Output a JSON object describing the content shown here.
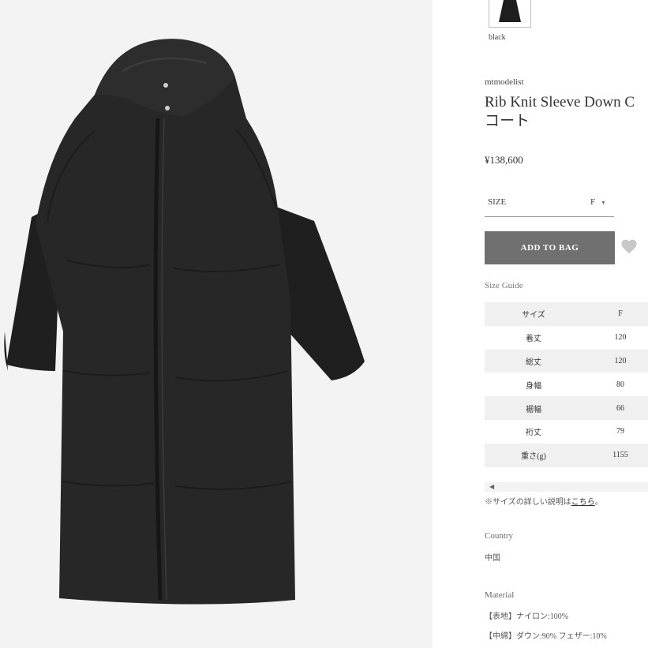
{
  "product": {
    "color_label": "black",
    "brand": "mtmodelist",
    "title_line1": "Rib Knit Sleeve Down C",
    "title_line2": "コート",
    "price": "¥138,600",
    "image_icon": "hooded-down-coat-image"
  },
  "size_select": {
    "label": "SIZE",
    "value": "F",
    "icon": "caret-down-icon"
  },
  "actions": {
    "add_to_bag": "ADD TO BAG",
    "wishlist_icon": "heart-icon"
  },
  "size_guide": {
    "link": "Size Guide",
    "rows": [
      {
        "label": "サイズ",
        "value": "F"
      },
      {
        "label": "着丈",
        "value": "120"
      },
      {
        "label": "総丈",
        "value": "120"
      },
      {
        "label": "身幅",
        "value": "80"
      },
      {
        "label": "裾幅",
        "value": "66"
      },
      {
        "label": "裄丈",
        "value": "79"
      },
      {
        "label": "重さ(g)",
        "value": "1155"
      }
    ],
    "scroll_left_icon": "chevron-left-icon",
    "note_prefix": "※サイズの詳しい説明は",
    "note_link": "こちら",
    "note_suffix": "。"
  },
  "details": {
    "country_label": "Country",
    "country_value": "中国",
    "material_label": "Material",
    "material_lines": [
      "【表地】ナイロン:100%",
      "【中綿】ダウン:90% フェザー:10%"
    ]
  },
  "colors": {
    "button": "#707070",
    "table_shade": "#f0f0f0",
    "coat": "#262626",
    "image_bg": "#f3f3f3"
  }
}
